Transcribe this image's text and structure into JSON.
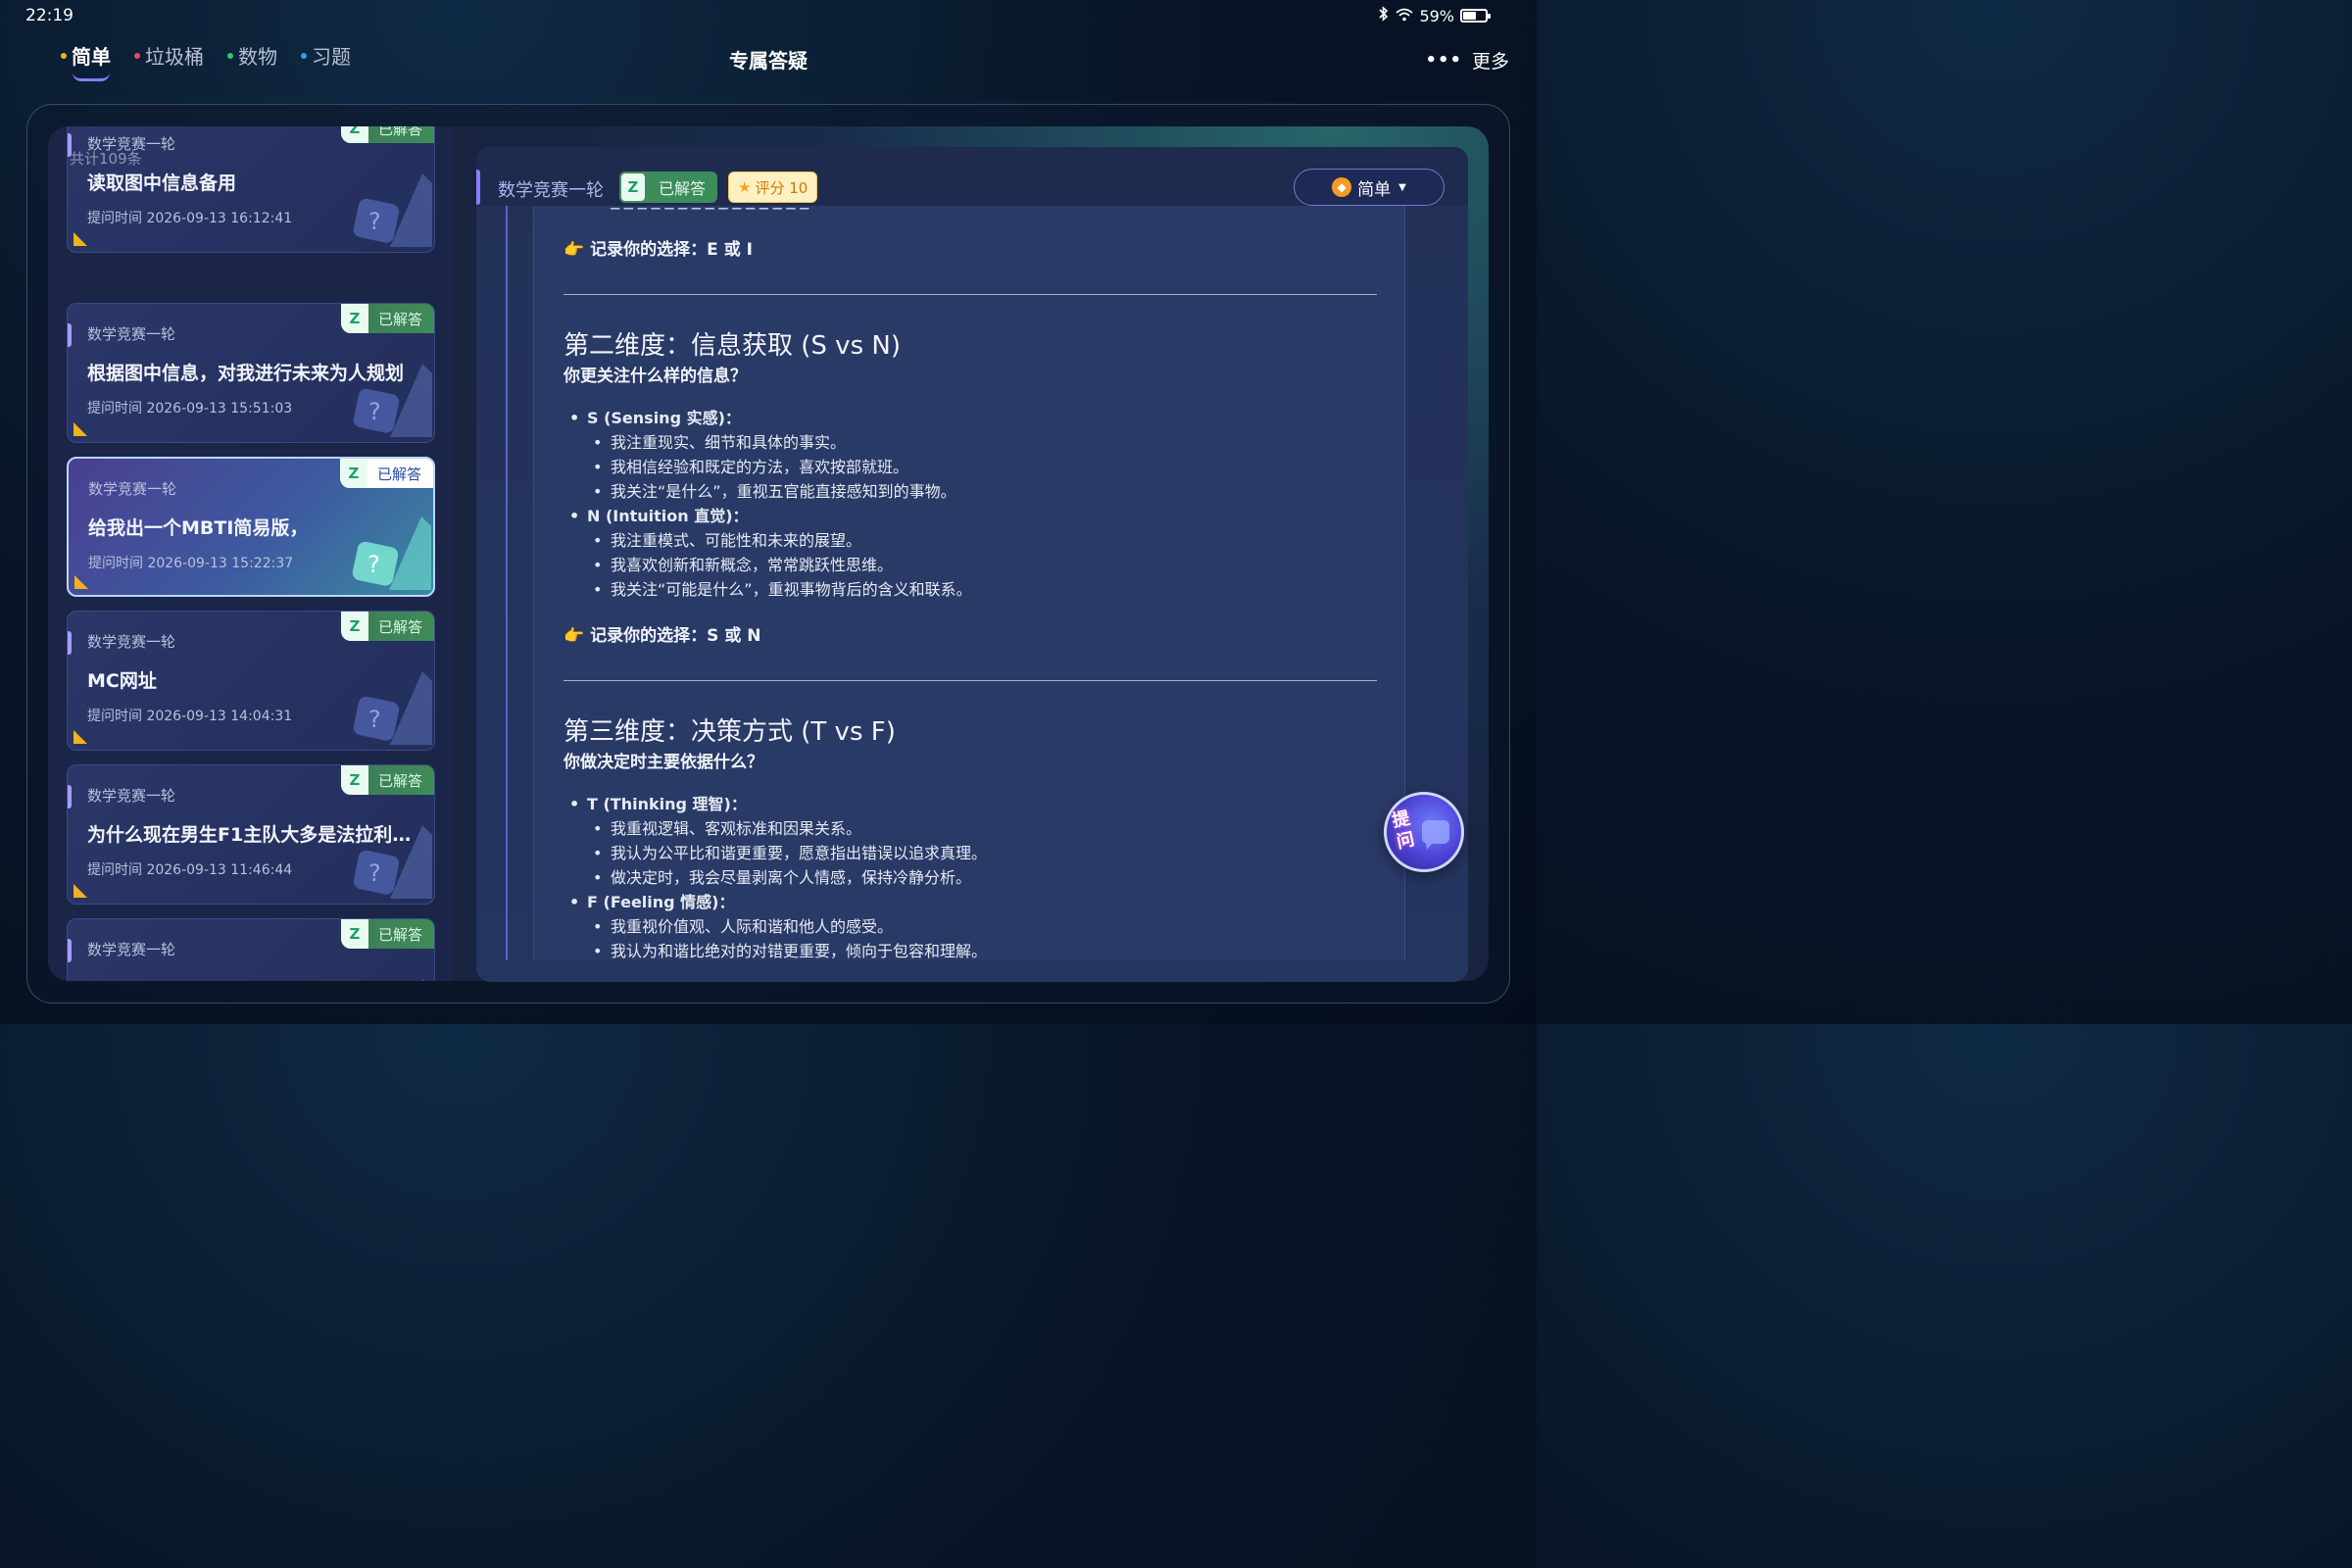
{
  "status": {
    "time": "22:19",
    "battery": "59%",
    "battery_level": 0.59
  },
  "nav": {
    "tabs": [
      {
        "label": "简单",
        "dot": "#f2b21c",
        "active": true
      },
      {
        "label": "垃圾桶",
        "dot": "#e64b5c"
      },
      {
        "label": "数物",
        "dot": "#36c46b"
      },
      {
        "label": "习题",
        "dot": "#2ba3e8"
      }
    ],
    "title": "专属答疑",
    "more": "更多"
  },
  "sidebar": {
    "count": "共计109条",
    "cards": [
      {
        "category": "数学竞赛一轮",
        "question": "读取图中信息备用",
        "time": "提问时间 2026-09-13 16:12:41",
        "badge": "已解答"
      },
      {
        "category": "数学竞赛一轮",
        "question": "根据图中信息，对我进行未来为人规划",
        "time": "提问时间 2026-09-13 15:51:03",
        "badge": "已解答"
      },
      {
        "category": "数学竞赛一轮",
        "question": "给我出一个MBTI简易版，",
        "time": "提问时间 2026-09-13 15:22:37",
        "badge": "已解答",
        "selected": true
      },
      {
        "category": "数学竞赛一轮",
        "question": "MC网址",
        "time": "提问时间 2026-09-13 14:04:31",
        "badge": "已解答"
      },
      {
        "category": "数学竞赛一轮",
        "question": "为什么现在男生F1主队大多是法拉利…",
        "time": "提问时间 2026-09-13 11:46:44",
        "badge": "已解答"
      },
      {
        "category": "数学竞赛一轮",
        "question": "",
        "time": "",
        "badge": "已解答"
      }
    ]
  },
  "detail": {
    "category": "数学竞赛一轮",
    "badge_z": "Z",
    "badge": "已解答",
    "score": "评分 10",
    "level": "简单",
    "content": {
      "record1": "记录你的选择：E 或 I",
      "dim2_title": "第二维度：信息获取 (S vs N)",
      "dim2_sub": "你更关注什么样的信息？",
      "dim2_items": [
        {
          "label": "S (Sensing 实感)：",
          "subs": [
            "我注重现实、细节和具体的事实。",
            "我相信经验和既定的方法，喜欢按部就班。",
            "我关注“是什么”，重视五官能直接感知到的事物。"
          ]
        },
        {
          "label": "N (Intuition 直觉)：",
          "subs": [
            "我注重模式、可能性和未来的展望。",
            "我喜欢创新和新概念，常常跳跃性思维。",
            "我关注“可能是什么”，重视事物背后的含义和联系。"
          ]
        }
      ],
      "record2": "记录你的选择：S 或 N",
      "dim3_title": "第三维度：决策方式 (T vs F)",
      "dim3_sub": "你做决定时主要依据什么？",
      "dim3_items": [
        {
          "label": "T (Thinking 理智)：",
          "subs": [
            "我重视逻辑、客观标准和因果关系。",
            "我认为公平比和谐更重要，愿意指出错误以追求真理。",
            "做决定时，我会尽量剥离个人情感，保持冷静分析。"
          ]
        },
        {
          "label": "F (Feeling 情感)：",
          "subs": [
            "我重视价值观、人际和谐和他人的感受。",
            "我认为和谐比绝对的对错更重要，倾向于包容和理解。"
          ]
        }
      ]
    }
  },
  "ask_button": {
    "label": "提问"
  }
}
